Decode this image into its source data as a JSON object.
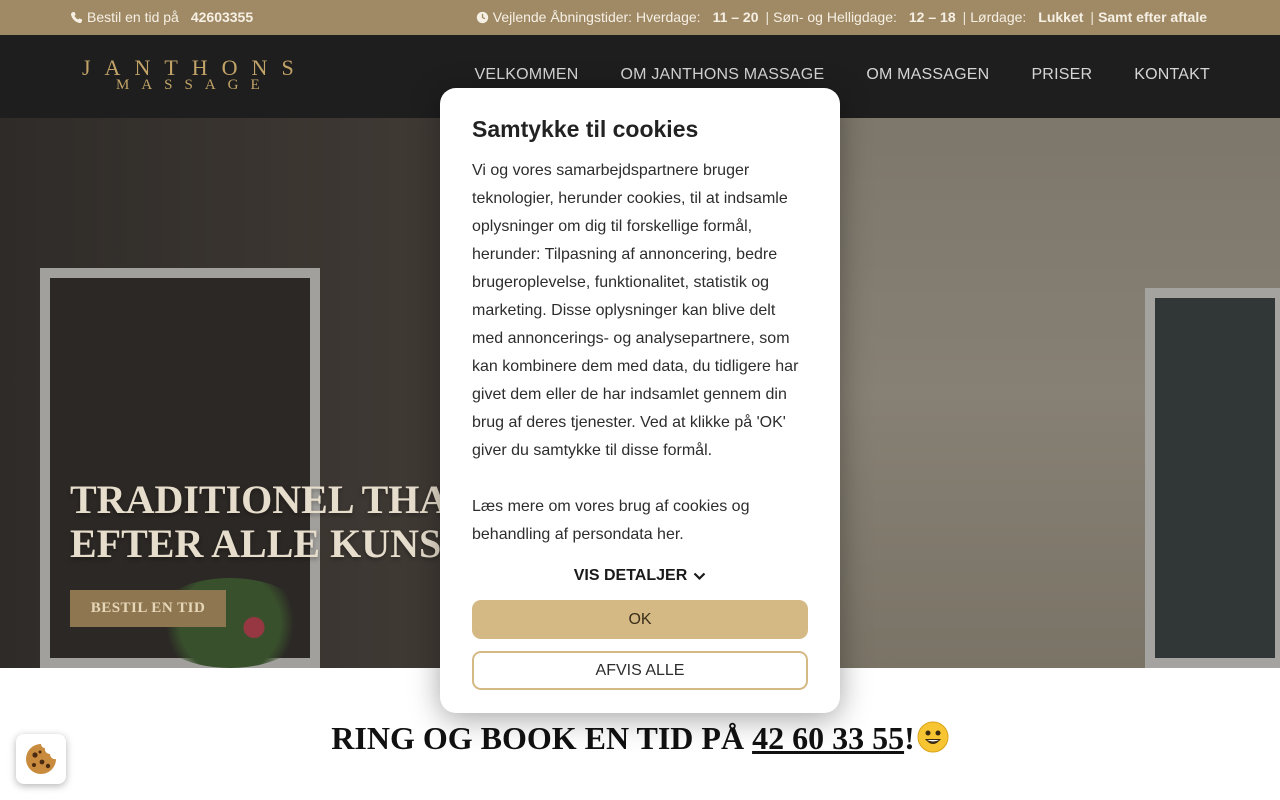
{
  "topbar": {
    "book_label": "Bestil en tid på",
    "book_phone": "42603355",
    "hours_label": "Vejlende Åbningstider: Hverdage:",
    "weekday_hours": "11 – 20",
    "sunday_label": "Søn- og Helligdage:",
    "sunday_hours": "12 – 18",
    "saturday_label": "Lørdage:",
    "saturday_hours": "Lukket",
    "extra": "Samt efter aftale",
    "phone_icon": "phone-icon",
    "clock_icon": "clock-icon"
  },
  "logo": {
    "line1": "JANTHONS",
    "line2": "MASSAGE"
  },
  "nav": {
    "items": [
      {
        "label": "VELKOMMEN"
      },
      {
        "label": "OM JANTHONS MASSAGE"
      },
      {
        "label": "OM MASSAGEN"
      },
      {
        "label": "PRISER"
      },
      {
        "label": "KONTAKT"
      }
    ]
  },
  "hero": {
    "title_line1": "TRADITIONEL THA",
    "title_line2": "EFTER ALLE KUNST",
    "button_label": "BESTIL EN TID"
  },
  "bottom": {
    "cta_prefix": "RING OG BOOK EN TID PÅ ",
    "cta_phone": "42 60 33 55",
    "cta_suffix": "!"
  },
  "cookie_modal": {
    "title": "Samtykke til cookies",
    "body": "Vi og vores samarbejdspartnere bruger teknologier, herunder cookies, til at indsamle oplysninger om dig til forskellige formål, herunder: Tilpasning af annoncering, bedre brugeroplevelse, funktionalitet, statistik og marketing. Disse oplysninger kan blive delt med annoncerings- og analysepartnere, som kan kombinere dem med data, du tidligere har givet dem eller de har indsamlet gennem din brug af deres tjenester. Ved at klikke på 'OK' giver du samtykke til disse formål.",
    "more_info": "Læs mere om vores brug af cookies og behandling af persondata her.",
    "details_label": "VIS DETALJER",
    "ok_label": "OK",
    "reject_label": "AFVIS ALLE"
  },
  "colors": {
    "topbar_bg": "#a08a66",
    "header_bg": "#1e1e1e",
    "accent_gold": "#d4b985"
  }
}
